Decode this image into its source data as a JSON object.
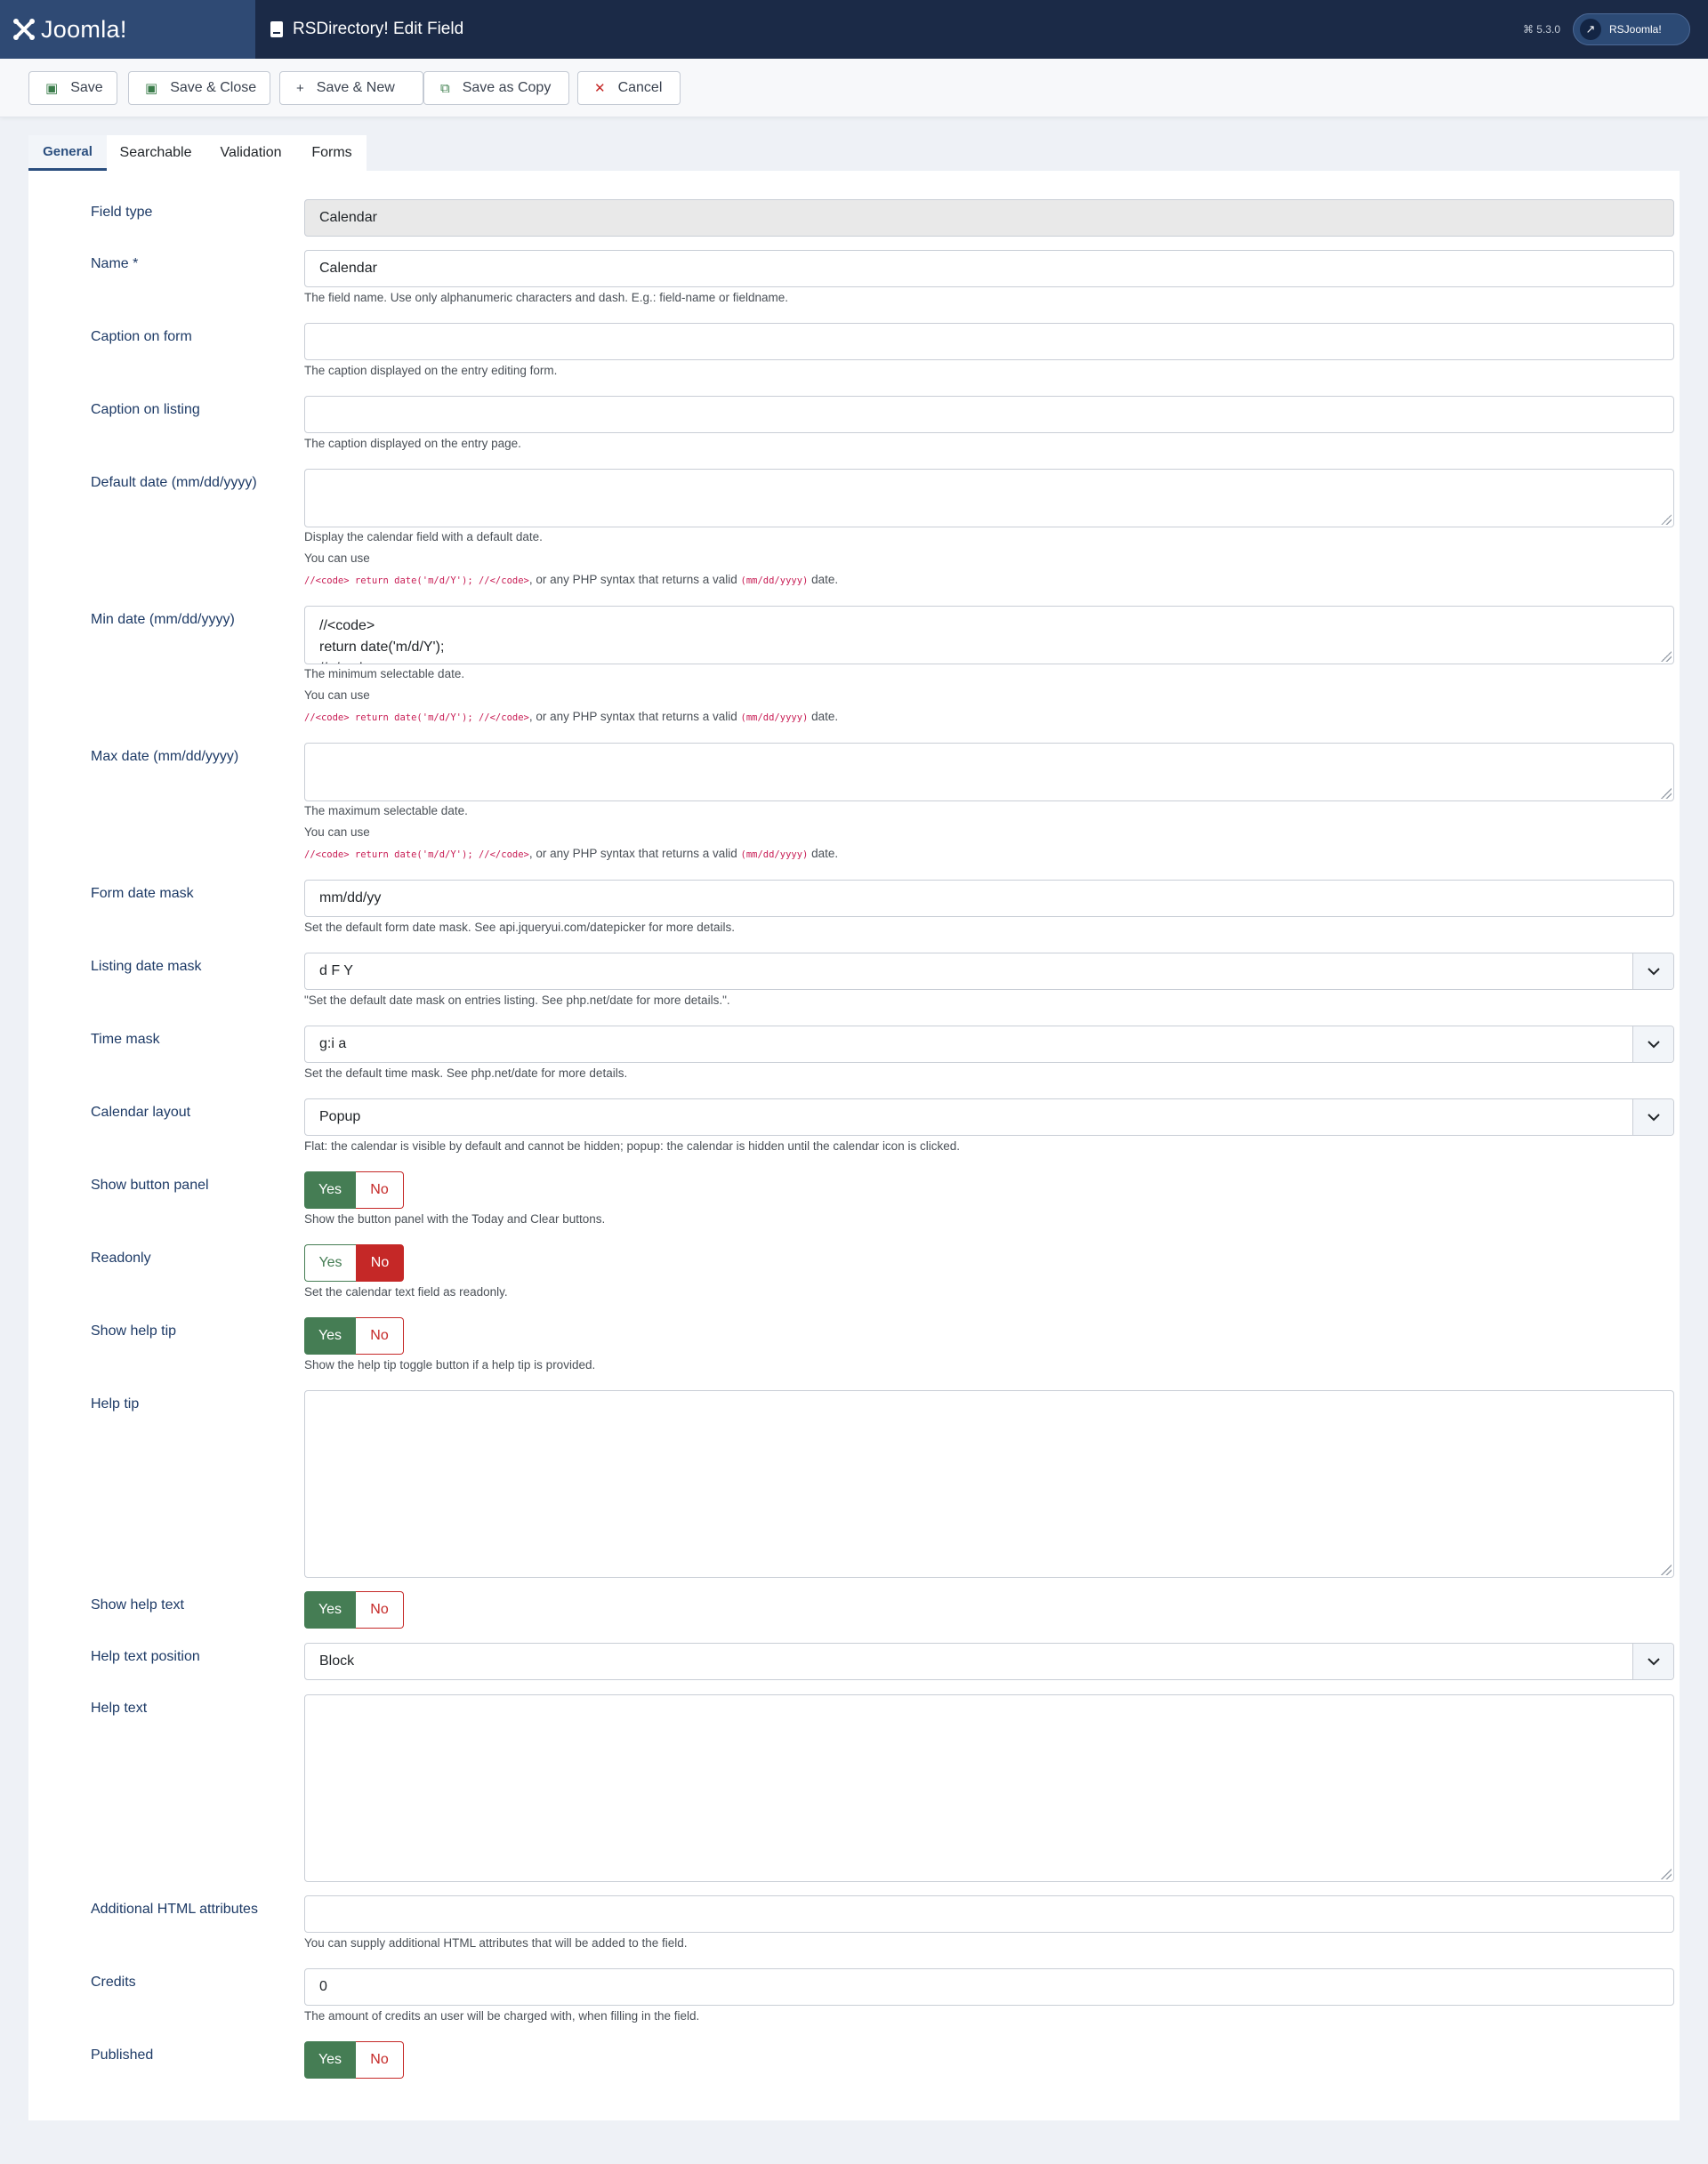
{
  "header": {
    "logo_text": "Joomla!",
    "page_title": "RSDirectory! Edit Field",
    "version": "5.3.0",
    "user_button": "RSJoomla!"
  },
  "toolbar": {
    "save": "Save",
    "save_close": "Save & Close",
    "save_new": "Save & New",
    "save_copy": "Save as Copy",
    "cancel": "Cancel"
  },
  "tabs": [
    "General",
    "Searchable",
    "Validation",
    "Forms"
  ],
  "form": {
    "field_type": {
      "label": "Field type",
      "value": "Calendar"
    },
    "name": {
      "label": "Name *",
      "value": "Calendar",
      "hint": "The field name. Use only alphanumeric characters and dash. E.g.: field-name or fieldname."
    },
    "caption_form": {
      "label": "Caption on form",
      "value": "",
      "hint": "The caption displayed on the entry editing form."
    },
    "caption_listing": {
      "label": "Caption on listing",
      "value": "",
      "hint": "The caption displayed on the entry page."
    },
    "default_date": {
      "label": "Default date (mm/dd/yyyy)",
      "value": "",
      "hint1": "Display the calendar field with a default date.",
      "hint2": "You can use",
      "code": "//<code> return date('m/d/Y'); //</code>",
      "hint3": ", or any PHP syntax that returns a valid ",
      "code2": "(mm/dd/yyyy)",
      "hint4": " date."
    },
    "min_date": {
      "label": "Min date (mm/dd/yyyy)",
      "value": "//<code>\nreturn date('m/d/Y');\n//</code>",
      "hint1": "The minimum selectable date.",
      "hint2": "You can use",
      "code": "//<code> return date('m/d/Y'); //</code>",
      "hint3": ", or any PHP syntax that returns a valid ",
      "code2": "(mm/dd/yyyy)",
      "hint4": " date."
    },
    "max_date": {
      "label": "Max date (mm/dd/yyyy)",
      "value": "",
      "hint1": "The maximum selectable date.",
      "hint2": "You can use",
      "code": "//<code> return date('m/d/Y'); //</code>",
      "hint3": ", or any PHP syntax that returns a valid ",
      "code2": "(mm/dd/yyyy)",
      "hint4": " date."
    },
    "form_mask": {
      "label": "Form date mask",
      "value": "mm/dd/yy",
      "hint": "Set the default form date mask. See api.jqueryui.com/datepicker for more details."
    },
    "listing_mask": {
      "label": "Listing date mask",
      "value": "d F Y",
      "hint": "\"Set the default date mask on entries listing. See php.net/date for more details.\"."
    },
    "time_mask": {
      "label": "Time mask",
      "value": "g:i a",
      "hint": "Set the default time mask. See php.net/date for more details."
    },
    "calendar_layout": {
      "label": "Calendar layout",
      "value": "Popup",
      "hint": "Flat: the calendar is visible by default and cannot be hidden; popup: the calendar is hidden until the calendar icon is clicked."
    },
    "show_button_panel": {
      "label": "Show button panel",
      "value": "Yes",
      "hint": "Show the button panel with the Today and Clear buttons."
    },
    "readonly": {
      "label": "Readonly",
      "value": "No",
      "hint": "Set the calendar text field as readonly."
    },
    "show_help_tip": {
      "label": "Show help tip",
      "value": "Yes",
      "hint": "Show the help tip toggle button if a help tip is provided."
    },
    "help_tip": {
      "label": "Help tip",
      "value": ""
    },
    "show_help_text": {
      "label": "Show help text",
      "value": "Yes"
    },
    "help_text_position": {
      "label": "Help text position",
      "value": "Block"
    },
    "help_text": {
      "label": "Help text",
      "value": ""
    },
    "html_attrs": {
      "label": "Additional HTML attributes",
      "value": "",
      "hint": "You can supply additional HTML attributes that will be added to the field."
    },
    "credits": {
      "label": "Credits",
      "value": "0",
      "hint": "The amount of credits an user will be charged with, when filling in the field."
    },
    "published": {
      "label": "Published",
      "value": "Yes"
    },
    "yes": "Yes",
    "no": "No"
  }
}
